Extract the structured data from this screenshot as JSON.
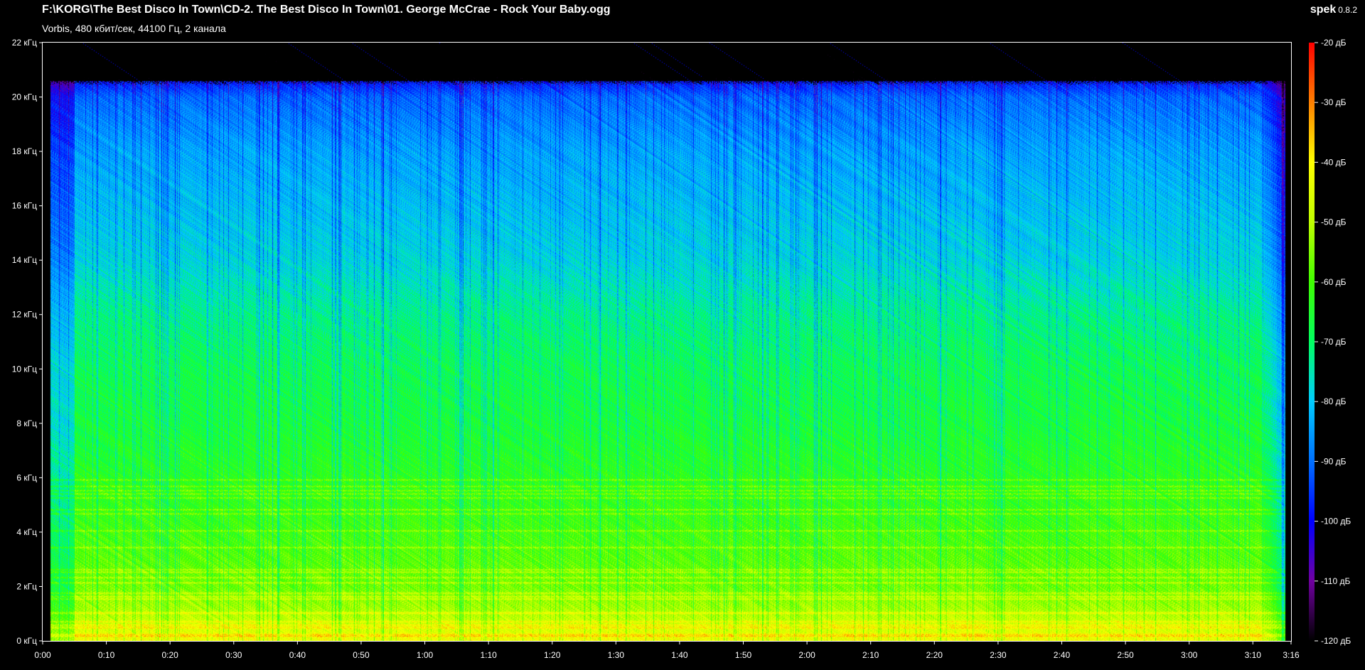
{
  "header": {
    "file_path": "F:\\KORG\\The Best Disco In Town\\CD-2. The Best Disco In Town\\01. George McCrae - Rock Your Baby.ogg",
    "audio_info": "Vorbis, 480 кбит/сек, 44100 Гц, 2 канала",
    "app_name": "spek",
    "app_version": "0.8.2"
  },
  "chart_data": {
    "type": "heatmap",
    "title": "",
    "xlabel": "",
    "ylabel": "",
    "x_unit": "time (m:ss)",
    "y_unit": "frequency (kHz)",
    "xlim_seconds": [
      0,
      196
    ],
    "ylim_khz": [
      0,
      22
    ],
    "x_ticks": [
      {
        "seconds": 0,
        "label": "0:00"
      },
      {
        "seconds": 10,
        "label": "0:10"
      },
      {
        "seconds": 20,
        "label": "0:20"
      },
      {
        "seconds": 30,
        "label": "0:30"
      },
      {
        "seconds": 40,
        "label": "0:40"
      },
      {
        "seconds": 50,
        "label": "0:50"
      },
      {
        "seconds": 60,
        "label": "1:00"
      },
      {
        "seconds": 70,
        "label": "1:10"
      },
      {
        "seconds": 80,
        "label": "1:20"
      },
      {
        "seconds": 90,
        "label": "1:30"
      },
      {
        "seconds": 100,
        "label": "1:40"
      },
      {
        "seconds": 110,
        "label": "1:50"
      },
      {
        "seconds": 120,
        "label": "2:00"
      },
      {
        "seconds": 130,
        "label": "2:10"
      },
      {
        "seconds": 140,
        "label": "2:20"
      },
      {
        "seconds": 150,
        "label": "2:30"
      },
      {
        "seconds": 160,
        "label": "2:40"
      },
      {
        "seconds": 170,
        "label": "2:50"
      },
      {
        "seconds": 180,
        "label": "3:00"
      },
      {
        "seconds": 190,
        "label": "3:10"
      },
      {
        "seconds": 196,
        "label": "3:16"
      }
    ],
    "y_ticks": [
      {
        "khz": 0,
        "label": "0 кГц"
      },
      {
        "khz": 2,
        "label": "2 кГц"
      },
      {
        "khz": 4,
        "label": "4 кГц"
      },
      {
        "khz": 6,
        "label": "6 кГц"
      },
      {
        "khz": 8,
        "label": "8 кГц"
      },
      {
        "khz": 10,
        "label": "10 кГц"
      },
      {
        "khz": 12,
        "label": "12 кГц"
      },
      {
        "khz": 14,
        "label": "14 кГц"
      },
      {
        "khz": 16,
        "label": "16 кГц"
      },
      {
        "khz": 18,
        "label": "18 кГц"
      },
      {
        "khz": 20,
        "label": "20 кГц"
      },
      {
        "khz": 22,
        "label": "22 кГц"
      }
    ],
    "colorbar": {
      "range_db": [
        -120,
        -20
      ],
      "ticks": [
        {
          "db": -20,
          "label": "-20 дБ"
        },
        {
          "db": -30,
          "label": "-30 дБ"
        },
        {
          "db": -40,
          "label": "-40 дБ"
        },
        {
          "db": -50,
          "label": "-50 дБ"
        },
        {
          "db": -60,
          "label": "-60 дБ"
        },
        {
          "db": -70,
          "label": "-70 дБ"
        },
        {
          "db": -80,
          "label": "-80 дБ"
        },
        {
          "db": -90,
          "label": "-90 дБ"
        },
        {
          "db": -100,
          "label": "-100 дБ"
        },
        {
          "db": -110,
          "label": "-110 дБ"
        },
        {
          "db": -120,
          "label": "-120 дБ"
        }
      ],
      "colors": [
        {
          "db": -120,
          "color": "#000000"
        },
        {
          "db": -110,
          "color": "#7000a0"
        },
        {
          "db": -100,
          "color": "#0000ff"
        },
        {
          "db": -90,
          "color": "#0070ff"
        },
        {
          "db": -80,
          "color": "#00ccff"
        },
        {
          "db": -70,
          "color": "#00ff60"
        },
        {
          "db": -60,
          "color": "#40ff00"
        },
        {
          "db": -50,
          "color": "#c0ff00"
        },
        {
          "db": -40,
          "color": "#ffff00"
        },
        {
          "db": -30,
          "color": "#ff8000"
        },
        {
          "db": -20,
          "color": "#ff0000"
        }
      ]
    },
    "spectrum_profile": {
      "signal_start_seconds": 1.2,
      "signal_end_seconds": 195,
      "cutoff_khz": 20.6,
      "mean_level_db_by_khz": [
        {
          "khz": 0,
          "db": -42
        },
        {
          "khz": 1,
          "db": -50
        },
        {
          "khz": 2,
          "db": -56
        },
        {
          "khz": 4,
          "db": -60
        },
        {
          "khz": 6,
          "db": -63
        },
        {
          "khz": 8,
          "db": -66
        },
        {
          "khz": 10,
          "db": -68
        },
        {
          "khz": 12,
          "db": -72
        },
        {
          "khz": 14,
          "db": -78
        },
        {
          "khz": 16,
          "db": -81
        },
        {
          "khz": 18,
          "db": -84
        },
        {
          "khz": 20,
          "db": -90
        },
        {
          "khz": 20.6,
          "db": -98
        }
      ]
    }
  }
}
